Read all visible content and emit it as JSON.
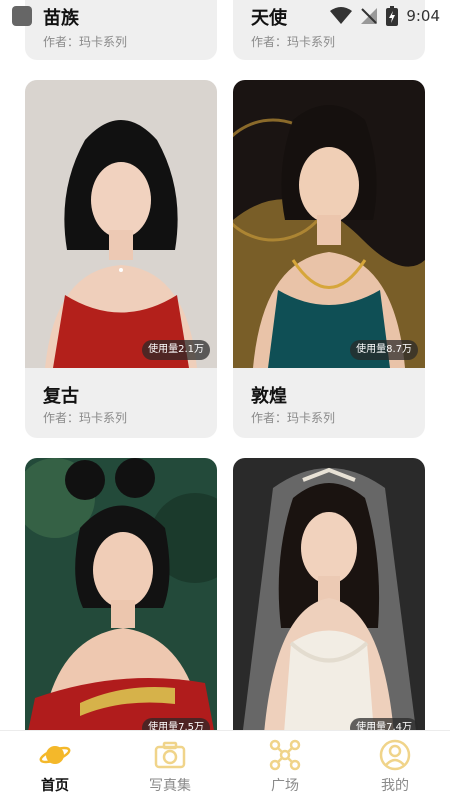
{
  "status_bar": {
    "time": "9:04"
  },
  "cards": [
    {
      "title": "苗族",
      "author_label": "作者：",
      "author": "玛卡系列"
    },
    {
      "title": "天使",
      "author_label": "作者：",
      "author": "玛卡系列"
    },
    {
      "title": "复古",
      "author_label": "作者：",
      "author": "玛卡系列",
      "usage": "使用量2.1万"
    },
    {
      "title": "敦煌",
      "author_label": "作者：",
      "author": "玛卡系列",
      "usage": "使用量8.7万"
    },
    {
      "usage": "使用量7.5万"
    },
    {
      "usage": "使用量7.4万"
    }
  ],
  "tabbar": {
    "items": [
      {
        "label": "首页",
        "icon": "planet-icon",
        "active": true
      },
      {
        "label": "写真集",
        "icon": "camera-icon",
        "active": false
      },
      {
        "label": "广场",
        "icon": "network-icon",
        "active": false
      },
      {
        "label": "我的",
        "icon": "user-icon",
        "active": false
      }
    ]
  },
  "colors": {
    "accent": "#f4b82a",
    "inactive_icon": "#f0d48a",
    "card_bg": "#efefef"
  }
}
